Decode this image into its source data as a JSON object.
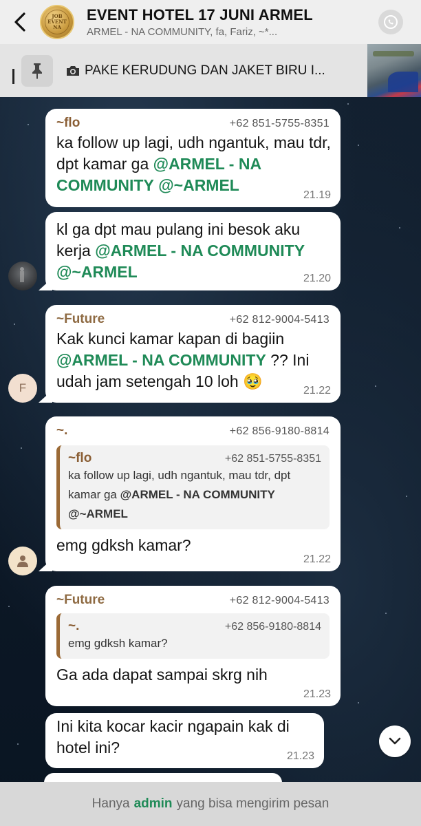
{
  "header": {
    "title": "EVENT HOTEL 17 JUNI ARMEL",
    "subtitle": "ARMEL - NA COMMUNITY, fa, Fariz, ~*...",
    "avatar_text_top": "JOB",
    "avatar_text_mid": "EVENT",
    "avatar_text_bot": "NA"
  },
  "pinned": {
    "text": "PAKE KERUDUNG DAN JAKET BIRU I..."
  },
  "messages": [
    {
      "sender": "~flo",
      "phone": "+62 851-5755-8351",
      "text_a": "ka follow up lagi, udh ngantuk, mau tdr, dpt kamar ga ",
      "mention_a": "@ARMEL - NA COMMUNITY",
      "text_b": " ",
      "mention_b": "@~ARMEL",
      "time": "21.19"
    },
    {
      "text_a": "kl ga dpt mau pulang ini besok aku kerja ",
      "mention_a": "@ARMEL - NA COMMUNITY",
      "text_b": " ",
      "mention_b": "@~ARMEL",
      "time": "21.20"
    },
    {
      "sender": "~Future",
      "phone": "+62 812-9004-5413",
      "text_a": "Kak kunci kamar kapan di bagiin ",
      "mention_a": "@ARMEL - NA COMMUNITY",
      "text_b": " ?? Ini udah jam setengah 10 loh 🥹",
      "avatar_letter": "F",
      "time": "21.22"
    },
    {
      "sender": "~.",
      "phone": "+62 856-9180-8814",
      "quote_sender": "~flo",
      "quote_phone": "+62 851-5755-8351",
      "quote_text_a": "ka follow up lagi, udh ngantuk, mau tdr, dpt kamar ga ",
      "quote_mention_a": "@ARMEL - NA COMMUNITY",
      "quote_text_b": " ",
      "quote_mention_b": "@~ARMEL",
      "text": "emg gdksh kamar?",
      "time": "21.22"
    },
    {
      "sender": "~Future",
      "phone": "+62 812-9004-5413",
      "quote_sender": "~.",
      "quote_phone": "+62 856-9180-8814",
      "quote_text": "emg gdksh kamar?",
      "text": "Ga ada dapat sampai skrg nih",
      "time": "21.23"
    },
    {
      "text": "Ini kita kocar kacir ngapain kak di hotel ini?",
      "time": "21.23"
    }
  ],
  "footer": {
    "prefix": "Hanya",
    "admin": "admin",
    "suffix": "yang bisa mengirim pesan"
  },
  "icons": {
    "back": "chevron-left-icon",
    "call": "call-icon",
    "pin": "pin-icon",
    "camera": "camera-icon",
    "scroll_down": "chevron-down-icon",
    "user": "user-icon"
  },
  "colors": {
    "mention": "#1f8a57",
    "sender": "#8a5e34",
    "header_bg": "#efefef",
    "chat_bg": "#0d1a28"
  }
}
